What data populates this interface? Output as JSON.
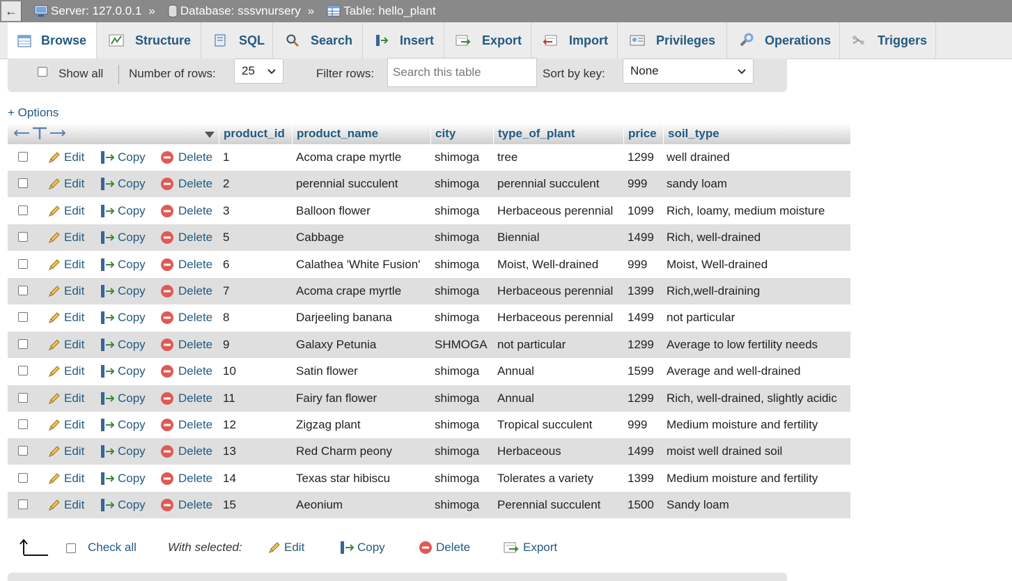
{
  "breadcrumb": {
    "back_icon": "←",
    "server": "Server: 127.0.0.1",
    "database": "Database: sssvnursery",
    "table": "Table: hello_plant",
    "separator": "»"
  },
  "tabs": [
    {
      "label": "Browse",
      "icon": "browse-icon",
      "active": true
    },
    {
      "label": "Structure",
      "icon": "structure-icon"
    },
    {
      "label": "SQL",
      "icon": "sql-icon"
    },
    {
      "label": "Search",
      "icon": "search-icon"
    },
    {
      "label": "Insert",
      "icon": "insert-icon"
    },
    {
      "label": "Export",
      "icon": "export-icon"
    },
    {
      "label": "Import",
      "icon": "import-icon"
    },
    {
      "label": "Privileges",
      "icon": "privileges-icon"
    },
    {
      "label": "Operations",
      "icon": "operations-icon"
    },
    {
      "label": "Triggers",
      "icon": "triggers-icon"
    }
  ],
  "navbar": {
    "show_all": "Show all",
    "rows_label": "Number of rows:",
    "rows_value": "25",
    "filter_label": "Filter rows:",
    "filter_placeholder": "Search this table",
    "sort_label": "Sort by key:",
    "sort_value": "None"
  },
  "options_link": "+ Options",
  "table": {
    "columns": [
      "product_id",
      "product_name",
      "city",
      "type_of_plant",
      "price",
      "soil_type"
    ],
    "actions": {
      "edit": "Edit",
      "copy": "Copy",
      "delete": "Delete"
    },
    "rows": [
      [
        "1",
        "Acoma crape myrtle",
        "shimoga",
        "tree",
        "1299",
        "well drained"
      ],
      [
        "2",
        "perennial succulent",
        "shimoga",
        "perennial succulent",
        "999",
        "sandy loam"
      ],
      [
        "3",
        "Balloon flower",
        "shimoga",
        "Herbaceous perennial",
        "1099",
        "Rich, loamy, medium moisture"
      ],
      [
        "5",
        "Cabbage",
        "shimoga",
        "Biennial",
        "1499",
        "Rich, well-drained"
      ],
      [
        "6",
        "Calathea 'White Fusion'",
        "shimoga",
        "Moist, Well-drained",
        "999",
        "Moist, Well-drained"
      ],
      [
        "7",
        "Acoma crape myrtle",
        "shimoga",
        "Herbaceous perennial",
        "1399",
        "Rich,well-draining"
      ],
      [
        "8",
        "Darjeeling banana",
        "shimoga",
        "Herbaceous perennial",
        "1499",
        "not particular"
      ],
      [
        "9",
        "Galaxy Petunia",
        "SHMOGA",
        "not particular",
        "1299",
        "Average to low fertility needs"
      ],
      [
        "10",
        "Satin flower",
        "shimoga",
        "Annual",
        "1599",
        "Average and well-drained"
      ],
      [
        "11",
        "Fairy fan flower",
        "shimoga",
        "Annual",
        "1299",
        "Rich, well-drained, slightly acidic"
      ],
      [
        "12",
        "Zigzag plant",
        "shimoga",
        "Tropical succulent",
        "999",
        "Medium moisture and fertility"
      ],
      [
        "13",
        "Red Charm peony",
        "shimoga",
        "Herbaceous",
        "1499",
        "moist well drained soil"
      ],
      [
        "14",
        "Texas star hibiscu",
        "shimoga",
        "Tolerates a variety",
        "1399",
        "Medium moisture and fertility"
      ],
      [
        "15",
        "Aeonium",
        "shimoga",
        "Perennial succulent",
        "1500",
        "Sandy loam"
      ]
    ]
  },
  "bulk": {
    "check_all": "Check all",
    "with_selected": "With selected:",
    "edit": "Edit",
    "copy": "Copy",
    "delete": "Delete",
    "export": "Export"
  }
}
